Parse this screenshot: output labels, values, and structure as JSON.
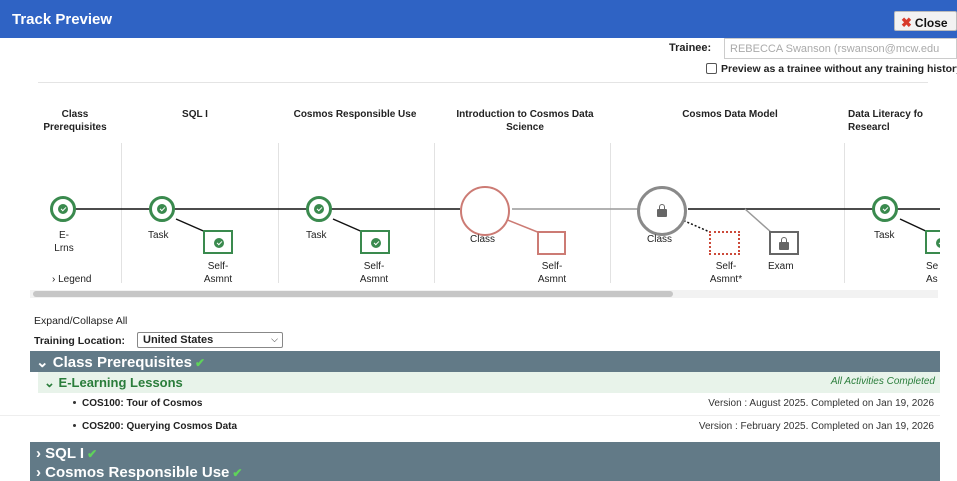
{
  "window": {
    "title": "Track Preview",
    "close_label": "Close",
    "close_icon": "x-icon"
  },
  "trainee": {
    "label": "Trainee:",
    "value": "REBECCA Swanson (rswanson@mcw.edu",
    "preview_label": "Preview as a trainee without any training history",
    "preview_checked": false
  },
  "track": {
    "steps": [
      {
        "title": "Class Prerequisites"
      },
      {
        "title": "SQL I"
      },
      {
        "title": "Cosmos Responsible Use"
      },
      {
        "title": "Introduction to Cosmos Data Science"
      },
      {
        "title": "Cosmos Data Model"
      },
      {
        "title": "Data Literacy fo Researcl"
      }
    ],
    "nodes": {
      "elrns": "E-\nLrns",
      "task1": "Task",
      "selfasmnt1": "Self-\nAsmnt",
      "task2": "Task",
      "selfasmnt2": "Self-\nAsmnt",
      "class3": "Class",
      "selfasmnt3": "Self-\nAsmnt",
      "class4": "Class",
      "selfasmnt4": "Self-\nAsmnt*",
      "exam4": "Exam",
      "task5": "Task",
      "selfasmnt5": "Se\nAs"
    },
    "legend_label": "Legend",
    "colors": {
      "complete": "#3a8a4e",
      "incomplete": "#cc7b74",
      "locked": "#8a8a8a"
    }
  },
  "controls": {
    "expand_label": "Expand/Collapse All",
    "location_label": "Training Location:",
    "location_value": "United States"
  },
  "sections": [
    {
      "title": "Class Prerequisites",
      "complete": true,
      "expanded": true,
      "subsections": [
        {
          "title": "E-Learning Lessons",
          "status": "All Activities Completed",
          "items": [
            {
              "name": "COS100: Tour of Cosmos",
              "version": "Version : August 2025. Completed on Jan 19, 2026"
            },
            {
              "name": "COS200: Querying Cosmos Data",
              "version": "Version : February 2025. Completed on Jan 19, 2026"
            }
          ]
        }
      ]
    },
    {
      "title": "SQL I",
      "complete": true,
      "expanded": false
    },
    {
      "title": "Cosmos Responsible Use",
      "complete": true,
      "expanded": false
    }
  ],
  "icons": {
    "chevron_down": "⌄",
    "chevron_right": "›",
    "check": "✔"
  }
}
